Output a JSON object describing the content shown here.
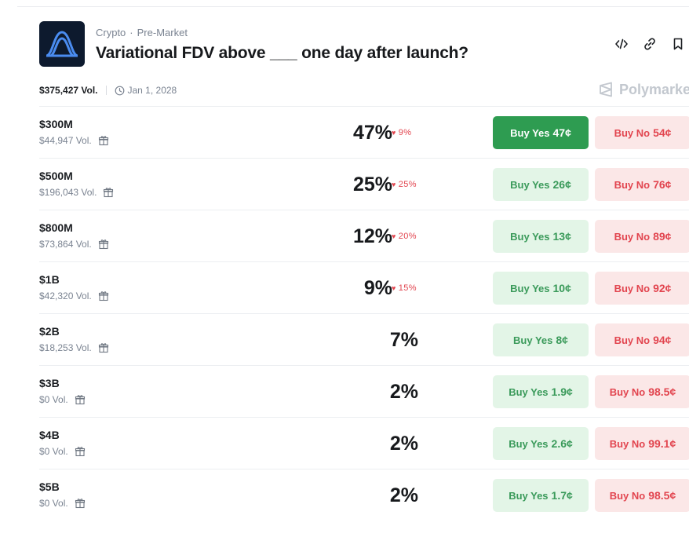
{
  "header": {
    "category": "Crypto",
    "subcategory": "Pre-Market",
    "title": "Variational FDV above ___ one day after launch?",
    "logo_icon": "variational-logo",
    "actions": [
      {
        "icon": "embed-code-icon"
      },
      {
        "icon": "link-icon"
      },
      {
        "icon": "bookmark-icon"
      }
    ]
  },
  "meta": {
    "volume": "$375,427 Vol.",
    "date": "Jan 1, 2028"
  },
  "brand": {
    "name": "Polymarket"
  },
  "colors": {
    "yes_active": "#2e9c51",
    "yes_bg": "#e3f5e7",
    "yes_text": "#3a9a5a",
    "no_bg": "#fbe7e7",
    "no_text": "#e2454f"
  },
  "outcomes": [
    {
      "label": "$300M",
      "volume": "$44,947 Vol.",
      "percent": "47%",
      "change": "9%",
      "yes_text": "Buy Yes",
      "yes_price": "47¢",
      "no_text": "Buy No",
      "no_price": "54¢",
      "yes_active": true
    },
    {
      "label": "$500M",
      "volume": "$196,043 Vol.",
      "percent": "25%",
      "change": "25%",
      "yes_text": "Buy Yes",
      "yes_price": "26¢",
      "no_text": "Buy No",
      "no_price": "76¢",
      "yes_active": false
    },
    {
      "label": "$800M",
      "volume": "$73,864 Vol.",
      "percent": "12%",
      "change": "20%",
      "yes_text": "Buy Yes",
      "yes_price": "13¢",
      "no_text": "Buy No",
      "no_price": "89¢",
      "yes_active": false
    },
    {
      "label": "$1B",
      "volume": "$42,320 Vol.",
      "percent": "9%",
      "change": "15%",
      "yes_text": "Buy Yes",
      "yes_price": "10¢",
      "no_text": "Buy No",
      "no_price": "92¢",
      "yes_active": false
    },
    {
      "label": "$2B",
      "volume": "$18,253 Vol.",
      "percent": "7%",
      "change": "",
      "yes_text": "Buy Yes",
      "yes_price": "8¢",
      "no_text": "Buy No",
      "no_price": "94¢",
      "yes_active": false
    },
    {
      "label": "$3B",
      "volume": "$0 Vol.",
      "percent": "2%",
      "change": "",
      "yes_text": "Buy Yes",
      "yes_price": "1.9¢",
      "no_text": "Buy No",
      "no_price": "98.5¢",
      "yes_active": false
    },
    {
      "label": "$4B",
      "volume": "$0 Vol.",
      "percent": "2%",
      "change": "",
      "yes_text": "Buy Yes",
      "yes_price": "2.6¢",
      "no_text": "Buy No",
      "no_price": "99.1¢",
      "yes_active": false
    },
    {
      "label": "$5B",
      "volume": "$0 Vol.",
      "percent": "2%",
      "change": "",
      "yes_text": "Buy Yes",
      "yes_price": "1.7¢",
      "no_text": "Buy No",
      "no_price": "98.5¢",
      "yes_active": false
    }
  ]
}
